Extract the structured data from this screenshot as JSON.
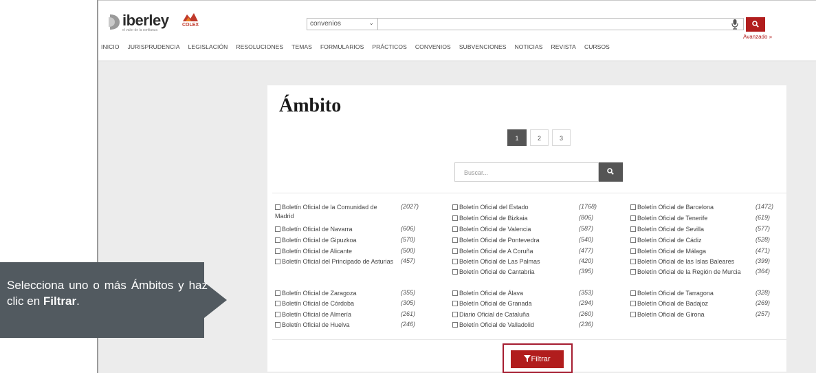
{
  "brand": {
    "name": "iberley",
    "tagline": "el valor de la confianza",
    "partner": "COLEX"
  },
  "search": {
    "scope_value": "convenios",
    "query": "",
    "advanced_label": "Avanzado »"
  },
  "nav": [
    "INICIO",
    "JURISPRUDENCIA",
    "LEGISLACIÓN",
    "RESOLUCIONES",
    "TEMAS",
    "FORMULARIOS",
    "PRÁCTICOS",
    "CONVENIOS",
    "SUBVENCIONES",
    "NOTICIAS",
    "REVISTA",
    "CURSOS"
  ],
  "panel": {
    "title": "Ámbito",
    "pages": [
      "1",
      "2",
      "3"
    ],
    "active_page": "1",
    "filter_placeholder": "Buscar...",
    "filter_button": "Filtrar",
    "items": [
      {
        "label": "Boletín Oficial de la Comunidad de Madrid",
        "count": "(2027)"
      },
      {
        "label": "Boletín Oficial de Navarra",
        "count": "(606)"
      },
      {
        "label": "Boletín Oficial de Gipuzkoa",
        "count": "(570)"
      },
      {
        "label": "Boletín Oficial de Alicante",
        "count": "(500)"
      },
      {
        "label": "Boletín Oficial del Principado de Asturias",
        "count": "(457)"
      },
      {
        "label": "Boletín Oficial de Zaragoza",
        "count": "(355)"
      },
      {
        "label": "Boletín Oficial de Córdoba",
        "count": "(305)"
      },
      {
        "label": "Boletín Oficial de Almería",
        "count": "(261)"
      },
      {
        "label": "Boletín Oficial de Huelva",
        "count": "(246)"
      },
      {
        "label": "Boletín Oficial del Estado",
        "count": "(1768)"
      },
      {
        "label": "Boletín Oficial de Bizkaia",
        "count": "(806)"
      },
      {
        "label": "Boletín Oficial de Valencia",
        "count": "(587)"
      },
      {
        "label": "Boletín Oficial de Pontevedra",
        "count": "(540)"
      },
      {
        "label": "Boletín Oficial de A Coruña",
        "count": "(477)"
      },
      {
        "label": "Boletín Oficial de Las Palmas",
        "count": "(420)"
      },
      {
        "label": "Boletín Oficial de Cantabria",
        "count": "(395)"
      },
      {
        "label": "Boletín Oficial de Álava",
        "count": "(353)"
      },
      {
        "label": "Boletín Oficial de Granada",
        "count": "(294)"
      },
      {
        "label": "Diario Oficial de Cataluña",
        "count": "(260)"
      },
      {
        "label": "Boletín Oficial de Valladolid",
        "count": "(236)"
      },
      {
        "label": "Boletín Oficial de Barcelona",
        "count": "(1472)"
      },
      {
        "label": "Boletín Oficial de Tenerife",
        "count": "(619)"
      },
      {
        "label": "Boletín Oficial de Sevilla",
        "count": "(577)"
      },
      {
        "label": "Boletín Oficial de Cádiz",
        "count": "(528)"
      },
      {
        "label": "Boletín Oficial de Málaga",
        "count": "(471)"
      },
      {
        "label": "Boletín Oficial de las Islas Baleares",
        "count": "(399)"
      },
      {
        "label": "Boletín Oficial de la Región de Murcia",
        "count": "(364)"
      },
      {
        "label": "Boletín Oficial de Tarragona",
        "count": "(328)"
      },
      {
        "label": "Boletín Oficial de Badajoz",
        "count": "(269)"
      },
      {
        "label": "Boletín Oficial de Girona",
        "count": "(257)"
      }
    ]
  },
  "callout": {
    "text_before": "Selecciona uno o más Ámbitos y haz clic en ",
    "text_bold": "Filtrar",
    "text_after": "."
  },
  "colors": {
    "brand_red": "#b11d1d",
    "callout_bg": "#525a60"
  }
}
